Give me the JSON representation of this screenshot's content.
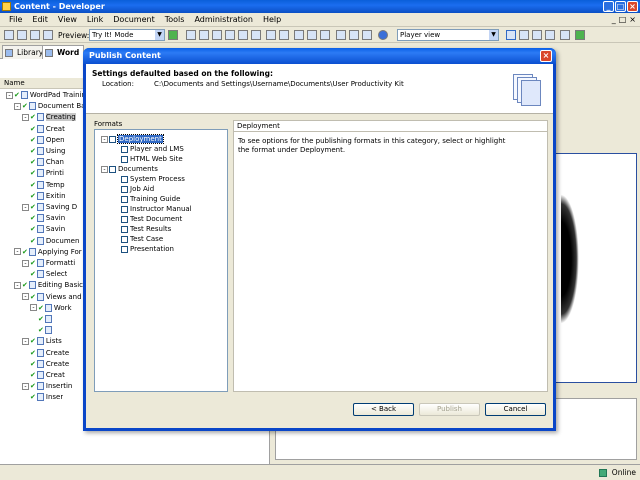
{
  "app": {
    "title": "Content - Developer",
    "win_min": "_",
    "win_max": "□",
    "win_close": "×"
  },
  "menu": [
    "File",
    "Edit",
    "View",
    "Link",
    "Document",
    "Tools",
    "Administration",
    "Help"
  ],
  "mdi_buttons": [
    "_",
    "□",
    "×"
  ],
  "toolbar": {
    "preview_label": "Preview:",
    "preview_mode": "Try It! Mode",
    "player_view": "Player view"
  },
  "left_panel": {
    "tab_library": "Library",
    "tab_word": "Word",
    "column_name": "Name",
    "tree": [
      {
        "text": "WordPad Training",
        "exp": "-"
      },
      {
        "text": "Document Ba",
        "exp": "-"
      },
      {
        "text": "Creating",
        "exp": "-"
      },
      {
        "text": "Creat",
        "exp": ""
      },
      {
        "text": "Open",
        "exp": ""
      },
      {
        "text": "Using",
        "exp": ""
      },
      {
        "text": "Chan",
        "exp": ""
      },
      {
        "text": "Printi",
        "exp": ""
      },
      {
        "text": "Temp",
        "exp": ""
      },
      {
        "text": "Exitin",
        "exp": ""
      },
      {
        "text": "Saving D",
        "exp": "-"
      },
      {
        "text": "Savin",
        "exp": ""
      },
      {
        "text": "Savin",
        "exp": ""
      },
      {
        "text": "Documen",
        "exp": ""
      },
      {
        "text": "Applying For",
        "exp": "-"
      },
      {
        "text": "Formatti",
        "exp": "-"
      },
      {
        "text": "Select",
        "exp": ""
      },
      {
        "text": "Editing Basic",
        "exp": "-"
      },
      {
        "text": "Views and",
        "exp": "-"
      },
      {
        "text": "Work",
        "exp": "-"
      },
      {
        "text": "",
        "exp": ""
      },
      {
        "text": "",
        "exp": ""
      },
      {
        "text": "Lists",
        "exp": "-"
      },
      {
        "text": "Create",
        "exp": ""
      },
      {
        "text": "Create",
        "exp": ""
      },
      {
        "text": "Creat",
        "exp": ""
      },
      {
        "text": "Insertin",
        "exp": "-"
      },
      {
        "text": "Inser",
        "exp": ""
      }
    ]
  },
  "status": {
    "online": "Online"
  },
  "dialog": {
    "title": "Publish Content",
    "close": "×",
    "header_title": "Settings defaulted based on the following:",
    "location_label": "Location:",
    "location_value": "C:\\Documents and Settings\\Username\\Documents\\User Productivity Kit",
    "formats_label": "Formats",
    "formats": [
      {
        "text": "Deployment",
        "level": 0,
        "exp": "-",
        "selected": true
      },
      {
        "text": "Player and LMS",
        "level": 1,
        "exp": "",
        "selected": false
      },
      {
        "text": "HTML Web Site",
        "level": 1,
        "exp": "",
        "selected": false
      },
      {
        "text": "Documents",
        "level": 0,
        "exp": "-",
        "selected": false
      },
      {
        "text": "System Process",
        "level": 1,
        "exp": "",
        "selected": false
      },
      {
        "text": "Job Aid",
        "level": 1,
        "exp": "",
        "selected": false
      },
      {
        "text": "Training Guide",
        "level": 1,
        "exp": "",
        "selected": false
      },
      {
        "text": "Instructor Manual",
        "level": 1,
        "exp": "",
        "selected": false
      },
      {
        "text": "Test Document",
        "level": 1,
        "exp": "",
        "selected": false
      },
      {
        "text": "Test Results",
        "level": 1,
        "exp": "",
        "selected": false
      },
      {
        "text": "Test Case",
        "level": 1,
        "exp": "",
        "selected": false
      },
      {
        "text": "Presentation",
        "level": 1,
        "exp": "",
        "selected": false
      }
    ],
    "desc_title": "Deployment",
    "desc_text": "To see options for the publishing formats in this category, select or highlight the format under Deployment.",
    "btn_back": "< Back",
    "btn_publish": "Publish",
    "btn_cancel": "Cancel"
  }
}
